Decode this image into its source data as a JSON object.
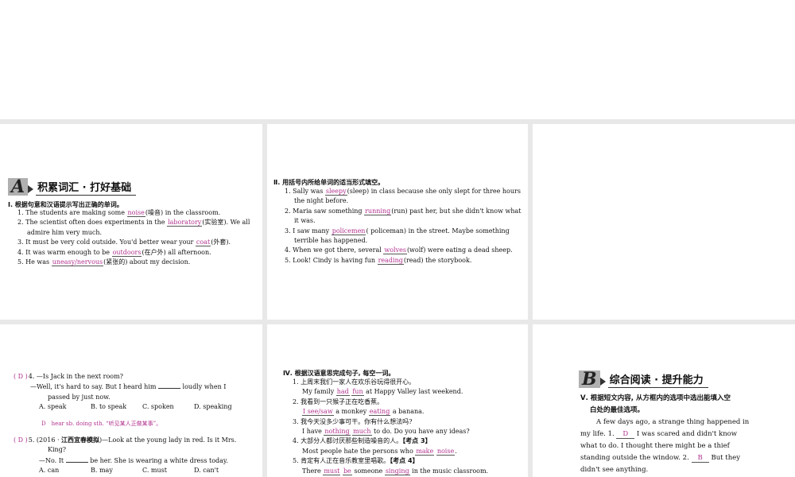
{
  "sectionA": {
    "letter": "A",
    "title": "积累词汇 · 打好基础"
  },
  "q1": {
    "title": "Ⅰ. 根据句意和汉语提示写出正确的单词。",
    "items": [
      {
        "pre": "1. The students are making some ",
        "ans": "noise",
        "post": "(噪音) in the classroom."
      },
      {
        "pre": "2. The scientist often does experiments in the ",
        "ans": "laboratory",
        "post": "(实验室). We all"
      },
      {
        "cont": "admire him very much."
      },
      {
        "pre": "3. It must be very cold outside. You'd better wear your ",
        "ans": "coat",
        "post": "(外套)."
      },
      {
        "pre": "4. It was warm enough to be ",
        "ans": "outdoors",
        "post": "(在户外) all afternoon."
      },
      {
        "pre": "5. He was ",
        "ans": "uneasy/nervous",
        "post": "(紧张的) about my decision."
      }
    ]
  },
  "q2": {
    "title": "Ⅱ. 用括号内所给单词的适当形式填空。",
    "items": [
      {
        "pre": "1. Sally was ",
        "ans": "sleepy",
        "post": "(sleep) in class because she only slept for three hours"
      },
      {
        "cont": "the night before."
      },
      {
        "pre": "2. Maria saw something ",
        "ans": "running",
        "post": "(run) past her, but she didn't know what"
      },
      {
        "cont": "it was."
      },
      {
        "pre": "3. I saw many ",
        "ans": "policemen",
        "post": "( policeman) in the street. Maybe something"
      },
      {
        "cont": "terrible has happened."
      },
      {
        "pre": "4. When we got there, several ",
        "ans": "wolves",
        "post": "(wolf) were eating a dead sheep."
      },
      {
        "pre": "5. Look! Cindy is having fun ",
        "ans": "reading",
        "post": "(read) the storybook."
      }
    ]
  },
  "mc": {
    "q4": {
      "paren": "( D )",
      "l1": "4. —Is Jack in the next room?",
      "l2a": "—Well, it's hard to say. But I heard him ",
      "l2b": " loudly when I",
      "l3": "passed by just now.",
      "choices": [
        "A. speak",
        "B. to speak",
        "C. spoken",
        "D. speaking"
      ],
      "note": "D　hear sb. doing sth. “听见某人正做某事”。"
    },
    "q5": {
      "paren": "( D )",
      "l1a": "5. (2016 · ",
      "l1src": "江西宜春模拟",
      "l1b": ")—Look at the young lady in red. Is it Mrs.",
      "l2": "King?",
      "l3a": "—No. It ",
      "l3b": " be her. She is wearing a white dress today.",
      "choices": [
        "A. can",
        "B. may",
        "C. must",
        "D. can't"
      ]
    }
  },
  "q4": {
    "title": "Ⅳ. 根据汉语意思完成句子, 每空一词。",
    "s1": {
      "cn": "1. 上周末我们一家人在欢乐谷玩得很开心。",
      "a": "My family ",
      "b1": "had",
      "c": " ",
      "b2": "fun",
      "d": " at Happy Valley last weekend."
    },
    "s2": {
      "cn": "2. 我看到一只猴子正在吃香蕉。",
      "b1": "I see/saw",
      "a": " a monkey ",
      "b2": "eating",
      "d": " a banana."
    },
    "s3": {
      "cn": "3. 我今天没多少事可干。你有什么想法吗?",
      "a": "I have ",
      "b1": "nothing",
      "c": " ",
      "b2": "much",
      "d": " to do. Do you have any ideas?"
    },
    "s4": {
      "cn": "4. 大部分人都讨厌那些制造噪音的人。",
      "tag": "【考点 3】",
      "a": "Most people hate the persons who ",
      "b1": "make",
      "c": " ",
      "b2": "noise",
      "d": "."
    },
    "s5": {
      "cn": "5. 肯定有人正在音乐教室里唱歌。",
      "tag": "【考点 4】",
      "a": "There ",
      "b1": "must",
      "c": " ",
      "b2": "be",
      "e": " someone ",
      "b3": "singing",
      "d": " in the music classroom."
    }
  },
  "sectionB": {
    "letter": "B",
    "title": "综合阅读 · 提升能力"
  },
  "q5": {
    "title1": "Ⅴ. 根据短文内容, 从方框内的选项中选出能填入空",
    "title2": "白处的最佳选项。",
    "l1": "A few days ago, a strange thing happened in",
    "l2a": "my life. 1. ",
    "a1": "D",
    "l2b": " I was scared and didn't know",
    "l3": "what to do. I thought there might be a thief",
    "l4a": "standing outside the window. 2. ",
    "a2": "B",
    "l4b": " But they",
    "l5": "didn't see anything."
  }
}
